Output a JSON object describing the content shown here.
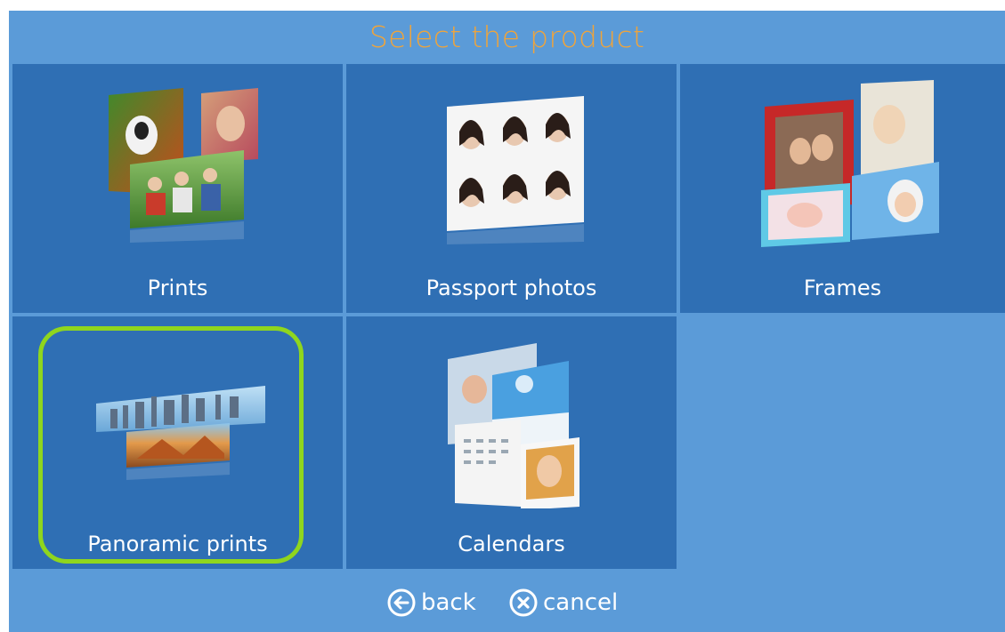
{
  "header": {
    "title": "Select the product"
  },
  "products": [
    {
      "label": "Prints",
      "icon": "prints-photos-icon"
    },
    {
      "label": "Passport photos",
      "icon": "passport-photos-icon"
    },
    {
      "label": "Frames",
      "icon": "frames-photos-icon"
    },
    {
      "label": "Panoramic prints",
      "icon": "panoramic-prints-icon"
    },
    {
      "label": "Calendars",
      "icon": "calendars-icon"
    }
  ],
  "footer": {
    "back_label": "back",
    "cancel_label": "cancel"
  },
  "colors": {
    "background": "#5b9bd8",
    "tile": "#2f6fb4",
    "title": "#f0a43a",
    "highlight": "#8fd61e"
  }
}
